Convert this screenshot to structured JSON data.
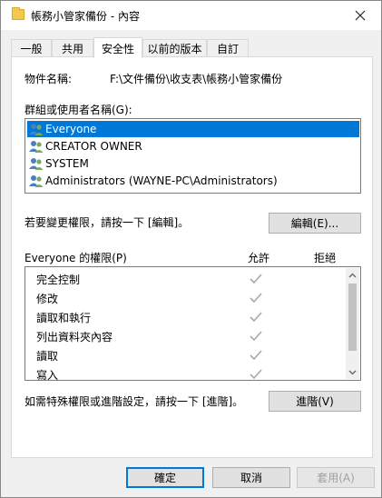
{
  "window": {
    "title": "帳務小管家備份 - 內容"
  },
  "tabs": [
    {
      "label": "一般"
    },
    {
      "label": "共用"
    },
    {
      "label": "安全性"
    },
    {
      "label": "以前的版本"
    },
    {
      "label": "自訂"
    }
  ],
  "object": {
    "label": "物件名稱:",
    "value": "F:\\文件備份\\收支表\\帳務小管家備份"
  },
  "groups": {
    "label": "群組或使用者名稱(G):",
    "items": [
      {
        "label": "Everyone"
      },
      {
        "label": "CREATOR OWNER"
      },
      {
        "label": "SYSTEM"
      },
      {
        "label": "Administrators (WAYNE-PC\\Administrators)"
      }
    ]
  },
  "edit": {
    "hint": "若要變更權限，請按一下 [編輯]。",
    "button": "編輯(E)..."
  },
  "permissions": {
    "header": "Everyone 的權限(P)",
    "allow_header": "允許",
    "deny_header": "拒絕",
    "rows": [
      {
        "label": "完全控制"
      },
      {
        "label": "修改"
      },
      {
        "label": "讀取和執行"
      },
      {
        "label": "列出資料夾內容"
      },
      {
        "label": "讀取"
      },
      {
        "label": "寫入"
      }
    ]
  },
  "advanced": {
    "hint": "如需特殊權限或進階設定，請按一下 [進階]。",
    "button": "進階(V)"
  },
  "footer": {
    "ok": "確定",
    "cancel": "取消",
    "apply": "套用(A)"
  }
}
